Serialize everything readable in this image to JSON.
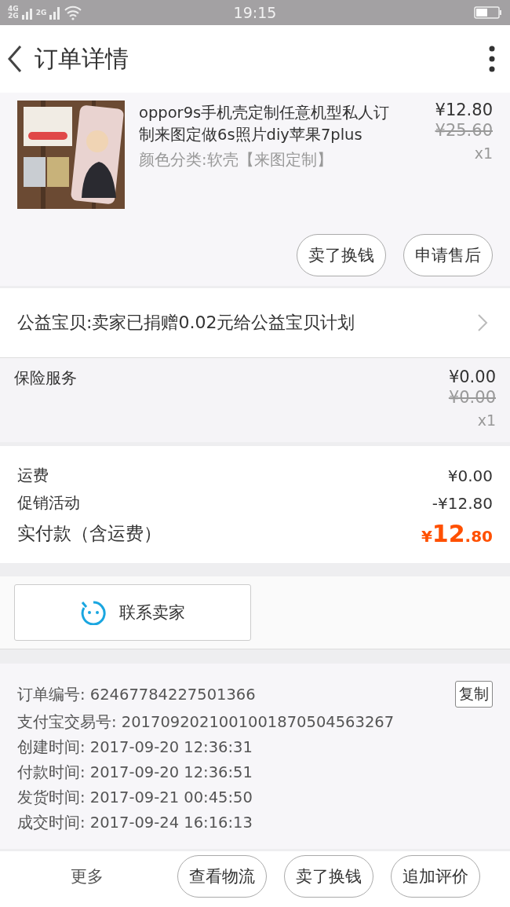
{
  "status_bar": {
    "network_labels": [
      "4G",
      "2G",
      "2G"
    ],
    "time": "19:15"
  },
  "header": {
    "title": "订单详情"
  },
  "product": {
    "image": {
      "kind": "picture"
    },
    "title": "oppor9s手机壳定制任意机型私人订制来图定做6s照片diy苹果7plus",
    "variant": "颜色分类:软壳【来图定制】",
    "price": "¥12.80",
    "original_price": "¥25.60",
    "quantity": "x1",
    "buttons": [
      "卖了换钱",
      "申请售后"
    ]
  },
  "charity": {
    "text": "公益宝贝:卖家已捐赠0.02元给公益宝贝计划"
  },
  "insurance": {
    "name": "保险服务",
    "price": "¥0.00",
    "original_price": "¥0.00",
    "quantity": "x1"
  },
  "costs": [
    {
      "kind": "line",
      "label": "运费",
      "value": "¥0.00"
    },
    {
      "kind": "line",
      "label": "促销活动",
      "value": "-¥12.80"
    },
    {
      "kind": "total",
      "label": "实付款（含运费）",
      "currency": "¥",
      "integer": "12",
      "fraction": ".80"
    }
  ],
  "contact": {
    "label": "联系卖家"
  },
  "order_info": {
    "lines": [
      "订单编号: 62467784227501366",
      "支付宝交易号: 2017092021001001870504563267",
      "创建时间: 2017-09-20 12:36:31",
      "付款时间: 2017-09-20 12:36:51",
      "发货时间: 2017-09-21 00:45:50",
      "成交时间: 2017-09-24 16:16:13"
    ],
    "copy_button": "复制"
  },
  "bottom_bar": {
    "more": "更多",
    "buttons": [
      "查看物流",
      "卖了换钱",
      "追加评价"
    ]
  }
}
